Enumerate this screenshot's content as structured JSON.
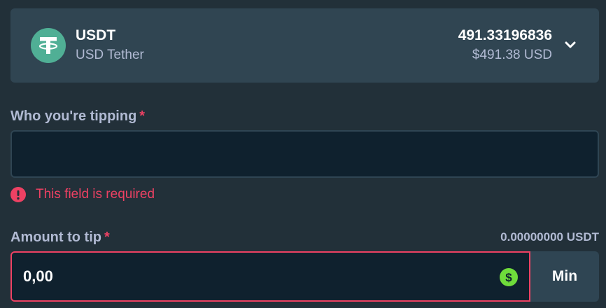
{
  "currency": {
    "symbol": "USDT",
    "name": "USD Tether",
    "balance_crypto": "491.33196836",
    "balance_fiat": "$491.38 USD",
    "icon": "tether-icon",
    "icon_color": "#50af95"
  },
  "recipient": {
    "label": "Who you're tipping",
    "required_marker": "*",
    "value": "",
    "error": "This field is required"
  },
  "amount": {
    "label": "Amount to tip",
    "required_marker": "*",
    "value": "0,00",
    "crypto_equivalent": "0.00000000 USDT",
    "currency_icon": "dollar-icon",
    "currency_icon_color": "#6fdc3b"
  },
  "min_button": {
    "label": "Min"
  },
  "colors": {
    "background": "#223039",
    "card": "#304552",
    "input": "#0f212e",
    "error": "#ed4163",
    "muted": "#b1bad3"
  }
}
